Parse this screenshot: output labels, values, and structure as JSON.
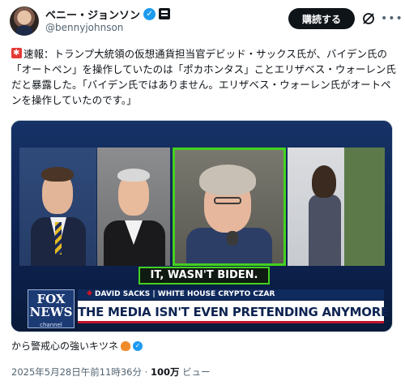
{
  "author": {
    "display_name": "ベニー・ジョンソン",
    "handle": "@bennyjohnson"
  },
  "header": {
    "subscribe_label": "購読する"
  },
  "tweet": {
    "prefix": "速報：",
    "text": "トランプ大統領の仮想通貨担当官デビッド・サックス氏が、バイデン氏の「オートペン」を操作していたのは「ポカホンタス」ことエリザベス・ウォーレン氏だと暴露した。「バイデン氏ではありません。エリザベス・ウォーレン氏がオートペンを操作していたのです。」"
  },
  "media": {
    "caption": "IT, WASN'T BIDEN.",
    "network_line1": "FOX",
    "network_line2": "NEWS",
    "network_line3": "channel",
    "chyron_top": "DAVID SACKS | WHITE HOUSE CRYPTO CZAR",
    "chyron_main": "THE MEDIA ISN'T EVEN PRETENDING ANYMORE"
  },
  "source": {
    "text": "から警戒心の強いキツネ"
  },
  "meta": {
    "timestamp": "2025年5月28日午前11時36分",
    "separator": "·",
    "views_count": "100万",
    "views_label": "ビュー"
  },
  "icons": [
    "verified-icon",
    "affiliation-badge-icon",
    "grok-icon",
    "more-icon",
    "siren-icon",
    "fox-emoji-icon"
  ],
  "colors": {
    "accent_blue": "#1d9bf0",
    "highlight_green": "#45d11e",
    "fox_red": "#c0152a",
    "fox_navy": "#0e2452"
  }
}
